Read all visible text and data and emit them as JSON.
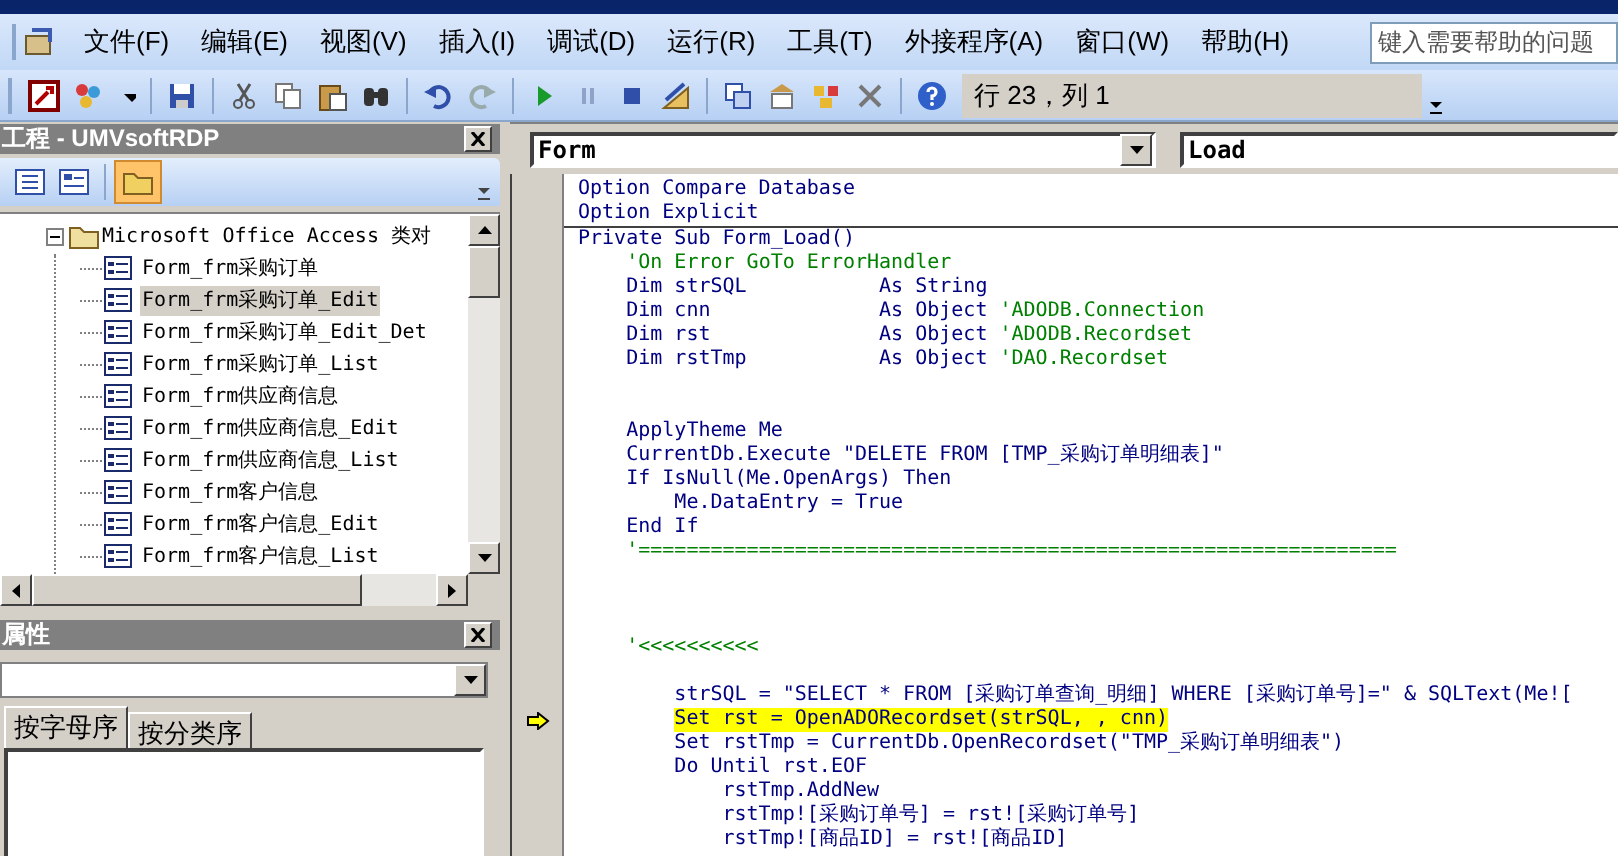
{
  "menu_bar": {
    "items": [
      {
        "label": "文件(F)"
      },
      {
        "label": "编辑(E)"
      },
      {
        "label": "视图(V)"
      },
      {
        "label": "插入(I)"
      },
      {
        "label": "调试(D)"
      },
      {
        "label": "运行(R)"
      },
      {
        "label": "工具(T)"
      },
      {
        "label": "外接程序(A)"
      },
      {
        "label": "窗口(W)"
      },
      {
        "label": "帮助(H)"
      }
    ],
    "help_search": {
      "placeholder": "键入需要帮助的问题"
    }
  },
  "toolbar": {
    "cursor_position": "行 23，列 1"
  },
  "project_panel": {
    "title": "工程 - UMVsoftRDP",
    "toggle_folders_on": true,
    "tree": [
      {
        "label": "Microsoft Office Access 类对",
        "expanded": true,
        "children": [
          {
            "label": "Form_frm采购订单",
            "selected": false
          },
          {
            "label": "Form_frm采购订单_Edit",
            "selected": true
          },
          {
            "label": "Form_frm采购订单_Edit_Det",
            "selected": false
          },
          {
            "label": "Form_frm采购订单_List",
            "selected": false
          },
          {
            "label": "Form_frm供应商信息",
            "selected": false
          },
          {
            "label": "Form_frm供应商信息_Edit",
            "selected": false
          },
          {
            "label": "Form_frm供应商信息_List",
            "selected": false
          },
          {
            "label": "Form_frm客户信息",
            "selected": false
          },
          {
            "label": "Form_frm客户信息_Edit",
            "selected": false
          },
          {
            "label": "Form_frm客户信息_List",
            "selected": false
          }
        ]
      }
    ]
  },
  "properties_panel": {
    "title": "属性",
    "tabs": [
      {
        "label": "按字母序",
        "selected": true
      },
      {
        "label": "按分类序",
        "selected": false
      }
    ]
  },
  "code_window": {
    "object": "Form",
    "procedure": "Load",
    "sections": [
      {
        "lines": [
          {
            "kind": "code",
            "current": false,
            "segments": [
              {
                "kind": "code",
                "text": "Option Compare Database"
              }
            ]
          },
          {
            "kind": "code",
            "current": false,
            "segments": [
              {
                "kind": "code",
                "text": "Option Explicit"
              }
            ]
          }
        ]
      },
      {
        "lines": [
          {
            "kind": "code",
            "current": false,
            "segments": [
              {
                "kind": "code",
                "text": "Private Sub Form_Load()"
              }
            ]
          },
          {
            "kind": "code",
            "current": false,
            "segments": [
              {
                "kind": "comment",
                "text": "    'On Error GoTo ErrorHandler"
              }
            ]
          },
          {
            "kind": "code",
            "current": false,
            "segments": [
              {
                "kind": "code",
                "text": "    Dim strSQL           As String"
              }
            ]
          },
          {
            "kind": "code",
            "current": false,
            "segments": [
              {
                "kind": "code",
                "text": "    Dim cnn              As Object "
              },
              {
                "kind": "comment",
                "text": "'ADODB.Connection"
              }
            ]
          },
          {
            "kind": "code",
            "current": false,
            "segments": [
              {
                "kind": "code",
                "text": "    Dim rst              As Object "
              },
              {
                "kind": "comment",
                "text": "'ADODB.Recordset"
              }
            ]
          },
          {
            "kind": "code",
            "current": false,
            "segments": [
              {
                "kind": "code",
                "text": "    Dim rstTmp           As Object "
              },
              {
                "kind": "comment",
                "text": "'DAO.Recordset"
              }
            ]
          },
          {
            "kind": "blank",
            "current": false
          },
          {
            "kind": "blank",
            "current": false
          },
          {
            "kind": "code",
            "current": false,
            "segments": [
              {
                "kind": "code",
                "text": "    ApplyTheme Me"
              }
            ]
          },
          {
            "kind": "code",
            "current": false,
            "segments": [
              {
                "kind": "code",
                "text": "    CurrentDb.Execute \"DELETE FROM [TMP_采购订单明细表]\""
              }
            ]
          },
          {
            "kind": "code",
            "current": false,
            "segments": [
              {
                "kind": "code",
                "text": "    If IsNull(Me.OpenArgs) Then"
              }
            ]
          },
          {
            "kind": "code",
            "current": false,
            "segments": [
              {
                "kind": "code",
                "text": "        Me.DataEntry = True"
              }
            ]
          },
          {
            "kind": "code",
            "current": false,
            "segments": [
              {
                "kind": "code",
                "text": "    End If"
              }
            ]
          },
          {
            "kind": "code",
            "current": false,
            "segments": [
              {
                "kind": "comment",
                "text": "    '==============================================================="
              }
            ]
          },
          {
            "kind": "blank",
            "current": false
          },
          {
            "kind": "blank",
            "current": false
          },
          {
            "kind": "blank",
            "current": false
          },
          {
            "kind": "code",
            "current": false,
            "segments": [
              {
                "kind": "comment",
                "text": "    '<<<<<<<<<<"
              }
            ]
          },
          {
            "kind": "blank",
            "current": false
          },
          {
            "kind": "code",
            "current": false,
            "segments": [
              {
                "kind": "code",
                "text": "        strSQL = \"SELECT * FROM [采购订单查询_明细] WHERE [采购订单号]=\" & SQLText(Me!["
              }
            ]
          },
          {
            "kind": "code",
            "current": true,
            "segments": [
              {
                "kind": "code",
                "text": "        Set rst = OpenADORecordset(strSQL, , cnn)"
              }
            ]
          },
          {
            "kind": "code",
            "current": false,
            "segments": [
              {
                "kind": "code",
                "text": "        Set rstTmp = CurrentDb.OpenRecordset(\"TMP_采购订单明细表\")"
              }
            ]
          },
          {
            "kind": "code",
            "current": false,
            "segments": [
              {
                "kind": "code",
                "text": "        Do Until rst.EOF"
              }
            ]
          },
          {
            "kind": "code",
            "current": false,
            "segments": [
              {
                "kind": "code",
                "text": "            rstTmp.AddNew"
              }
            ]
          },
          {
            "kind": "code",
            "current": false,
            "segments": [
              {
                "kind": "code",
                "text": "            rstTmp![采购订单号] = rst![采购订单号]"
              }
            ]
          },
          {
            "kind": "code",
            "current": false,
            "segments": [
              {
                "kind": "code",
                "text": "            rstTmp![商品ID] = rst![商品ID]"
              }
            ]
          }
        ]
      }
    ]
  }
}
